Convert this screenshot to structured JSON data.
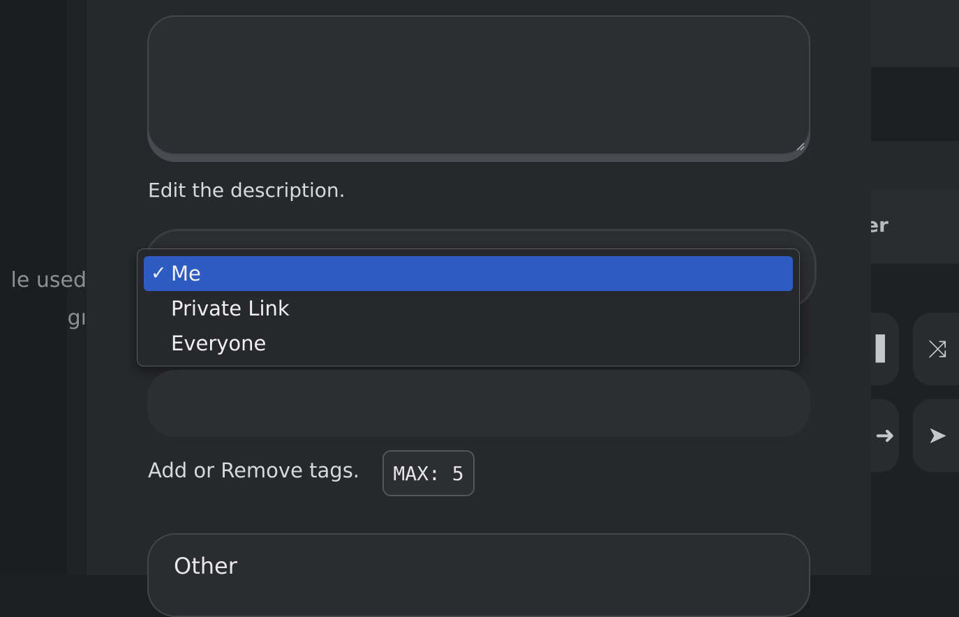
{
  "background": {
    "left_text_line1": "le used",
    "left_text_line2": "gı",
    "right_label": "er",
    "tiles": [
      {
        "icon": "bar-icon",
        "glyph": "▌"
      },
      {
        "icon": "shuffle-icon",
        "glyph": "⤨"
      },
      {
        "icon": "arrow-right-icon",
        "glyph": "➜"
      },
      {
        "icon": "send-icon",
        "glyph": "➤"
      }
    ]
  },
  "description": {
    "value": "",
    "help": "Edit the description."
  },
  "visibility": {
    "selected": "Me",
    "options": [
      {
        "label": "Me",
        "check": "✓"
      },
      {
        "label": "Private Link"
      },
      {
        "label": "Everyone"
      }
    ],
    "accent": "#2d5bbf"
  },
  "tags": {
    "help": "Add or Remove tags.",
    "max_badge": "MAX: 5"
  },
  "other": {
    "title": "Other"
  }
}
